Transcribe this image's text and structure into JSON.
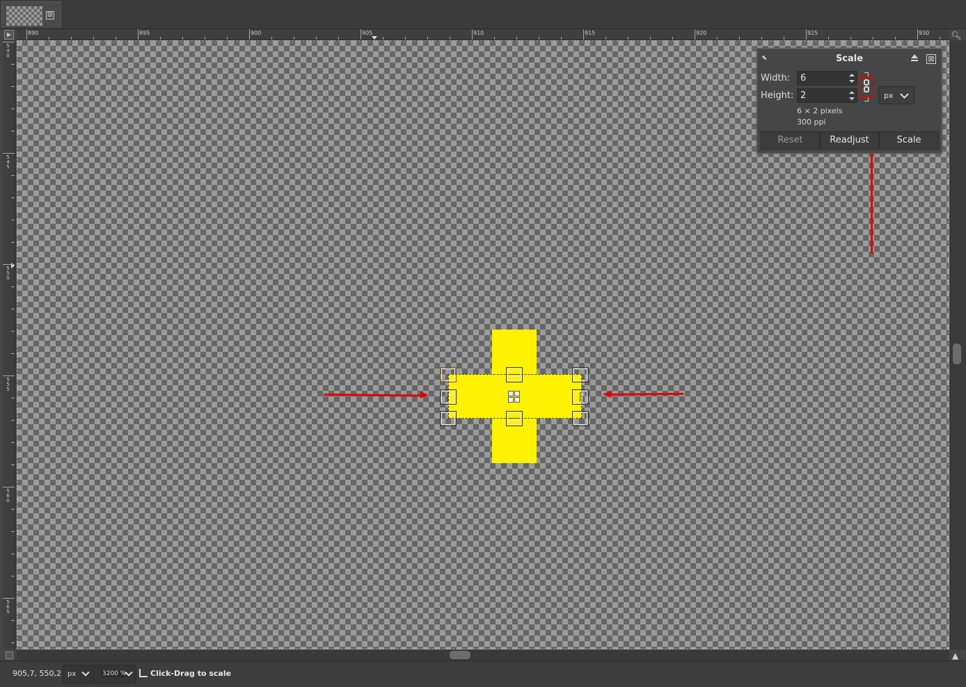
{
  "tab": {
    "close_glyph": "⊠"
  },
  "rulers": {
    "horizontal": [
      "890",
      "895",
      "900",
      "905",
      "910",
      "915",
      "920",
      "925",
      "930"
    ],
    "vertical": [
      "540",
      "545",
      "550",
      "555",
      "560",
      "565"
    ]
  },
  "scale_dialog": {
    "title": "Scale",
    "close_glyph": "⊠",
    "width_label": "Width:",
    "width_value": "6",
    "height_label": "Height:",
    "height_value": "2",
    "unit": "px",
    "size_info": "6 × 2 pixels",
    "resolution_info": "300 ppi",
    "buttons": {
      "reset": "Reset",
      "readjust": "Readjust",
      "scale": "Scale"
    },
    "chain_icon": "chain-link-icon"
  },
  "statusbar": {
    "coords": "905,7, 550,2",
    "unit": "px",
    "zoom": "3200 %",
    "message": "Click-Drag to scale"
  },
  "colors": {
    "shape": "#fff200",
    "annotation": "#e00000"
  },
  "icons": {
    "zoom_to_fit": "magnifier-icon",
    "navigate": "navigate-icon"
  }
}
